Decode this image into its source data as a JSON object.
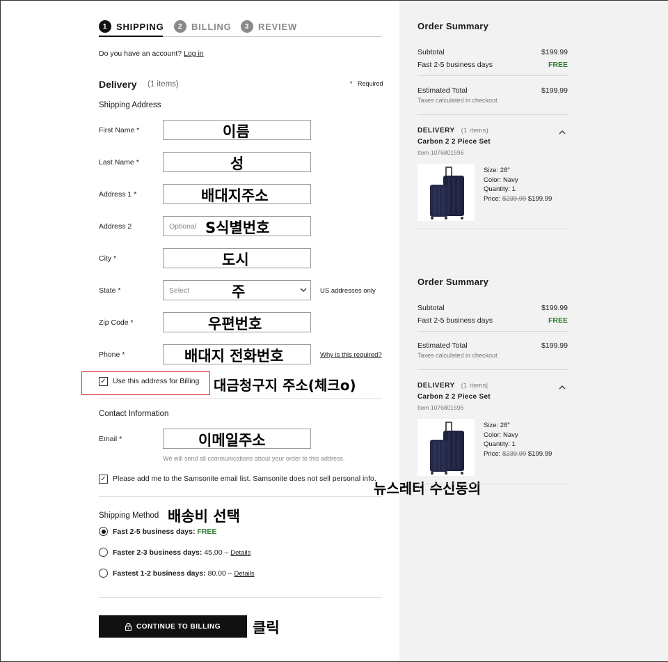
{
  "steps": [
    {
      "num": "1",
      "label": "SHIPPING"
    },
    {
      "num": "2",
      "label": "BILLING"
    },
    {
      "num": "3",
      "label": "REVIEW"
    }
  ],
  "account": {
    "prompt": "Do you have an account?",
    "login": "Log in"
  },
  "delivery": {
    "title": "Delivery",
    "count": "(1 items)",
    "required_mark": "*",
    "required": "Required"
  },
  "shipping_address_title": "Shipping Address",
  "form": {
    "first_name": {
      "label": "First Name *",
      "overlay": "이름"
    },
    "last_name": {
      "label": "Last Name *",
      "overlay": "성"
    },
    "address1": {
      "label": "Address 1 *",
      "overlay": "배대지주소"
    },
    "address2": {
      "label": "Address 2",
      "placeholder": "Optional",
      "overlay": "S식별번호"
    },
    "city": {
      "label": "City *",
      "overlay": "도시"
    },
    "state": {
      "label": "State *",
      "placeholder": "Select",
      "overlay": "주",
      "note": "US addresses only"
    },
    "zip": {
      "label": "Zip Code *",
      "overlay": "우편번호"
    },
    "phone": {
      "label": "Phone *",
      "overlay": "배대지 전화번호",
      "help": "Why is this required?"
    }
  },
  "billing_check": {
    "label": "Use this address for Billing",
    "overlay": "대금청구지 주소(체크o)"
  },
  "contact": {
    "title": "Contact Information",
    "email_label": "Email *",
    "email_overlay": "이메일주소",
    "email_note": "We will send all communications about your order to this address.",
    "newsletter": "Please add me to the Samsonite email list. Samsonite does not sell personal info.",
    "newsletter_overlay": "뉴스레터 수신동의"
  },
  "shipping_method": {
    "title": "Shipping Method",
    "overlay": "배송비 선택",
    "options": [
      {
        "name": "Fast 2-5 business days:",
        "price": "FREE",
        "details": ""
      },
      {
        "name": "Faster 2-3 business days:",
        "price": "45.00 –",
        "details": "Details"
      },
      {
        "name": "Fastest 1-2 business days:",
        "price": "80.00 –",
        "details": "Details"
      }
    ]
  },
  "continue": {
    "label": "CONTINUE TO BILLING",
    "overlay": "클릭"
  },
  "summaries": [
    {
      "title": "Order Summary",
      "subtotal_label": "Subtotal",
      "subtotal": "$199.99",
      "shipping_label": "Fast 2-5 business days",
      "shipping": "FREE",
      "total_label": "Estimated Total",
      "total": "$199.99",
      "tax_note": "Taxes calculated in checkout",
      "delivery_label": "DELIVERY",
      "delivery_count": "(1 items)",
      "product_name": "Carbon 2 2 Piece Set",
      "item_no": "Item 1076801596",
      "size": "Size: 28\"",
      "color": "Color: Navy",
      "quantity": "Quantity: 1",
      "price_label": "Price:",
      "price_old": "$239.99",
      "price_new": "$199.99"
    },
    {
      "title": "Order Summary",
      "subtotal_label": "Subtotal",
      "subtotal": "$199.99",
      "shipping_label": "Fast 2-5 business days",
      "shipping": "FREE",
      "total_label": "Estimated Total",
      "total": "$199.99",
      "tax_note": "Taxes calculated in checkout",
      "delivery_label": "DELIVERY",
      "delivery_count": "(1 items|",
      "product_name": "Carbon 2 2 Piece Set",
      "item_no": "Item 1076801596",
      "size": "Size: 28\"",
      "color": "Color: Navy",
      "quantity": "Quantity: 1",
      "price_label": "Price:",
      "price_old": "$239.99",
      "price_new": "$199.99"
    }
  ],
  "colors": {
    "accent": "#111111",
    "free": "#2e7d32",
    "highlight_box": "#d32f2f",
    "panel_bg": "#f2f2f2",
    "luggage": "#1f2340"
  }
}
